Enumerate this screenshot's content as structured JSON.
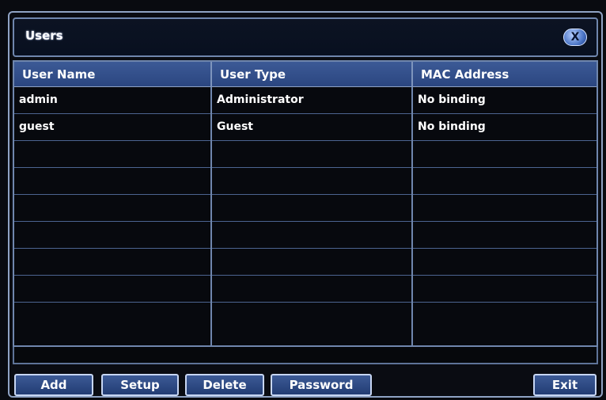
{
  "window": {
    "title": "Users",
    "close_label": "X"
  },
  "table": {
    "columns": [
      "User Name",
      "User Type",
      "MAC Address"
    ],
    "rows": [
      [
        "admin",
        "Administrator",
        "No binding"
      ],
      [
        "guest",
        "Guest",
        "No binding"
      ],
      [
        "",
        "",
        ""
      ],
      [
        "",
        "",
        ""
      ],
      [
        "",
        "",
        ""
      ],
      [
        "",
        "",
        ""
      ],
      [
        "",
        "",
        ""
      ],
      [
        "",
        "",
        ""
      ],
      [
        "",
        "",
        ""
      ]
    ]
  },
  "buttons": {
    "add": "Add",
    "setup": "Setup",
    "delete": "Delete",
    "password": "Password",
    "exit": "Exit"
  },
  "colors": {
    "header_blue": "#2b4680",
    "grid_line": "#6f86ad",
    "background": "#090b10"
  }
}
